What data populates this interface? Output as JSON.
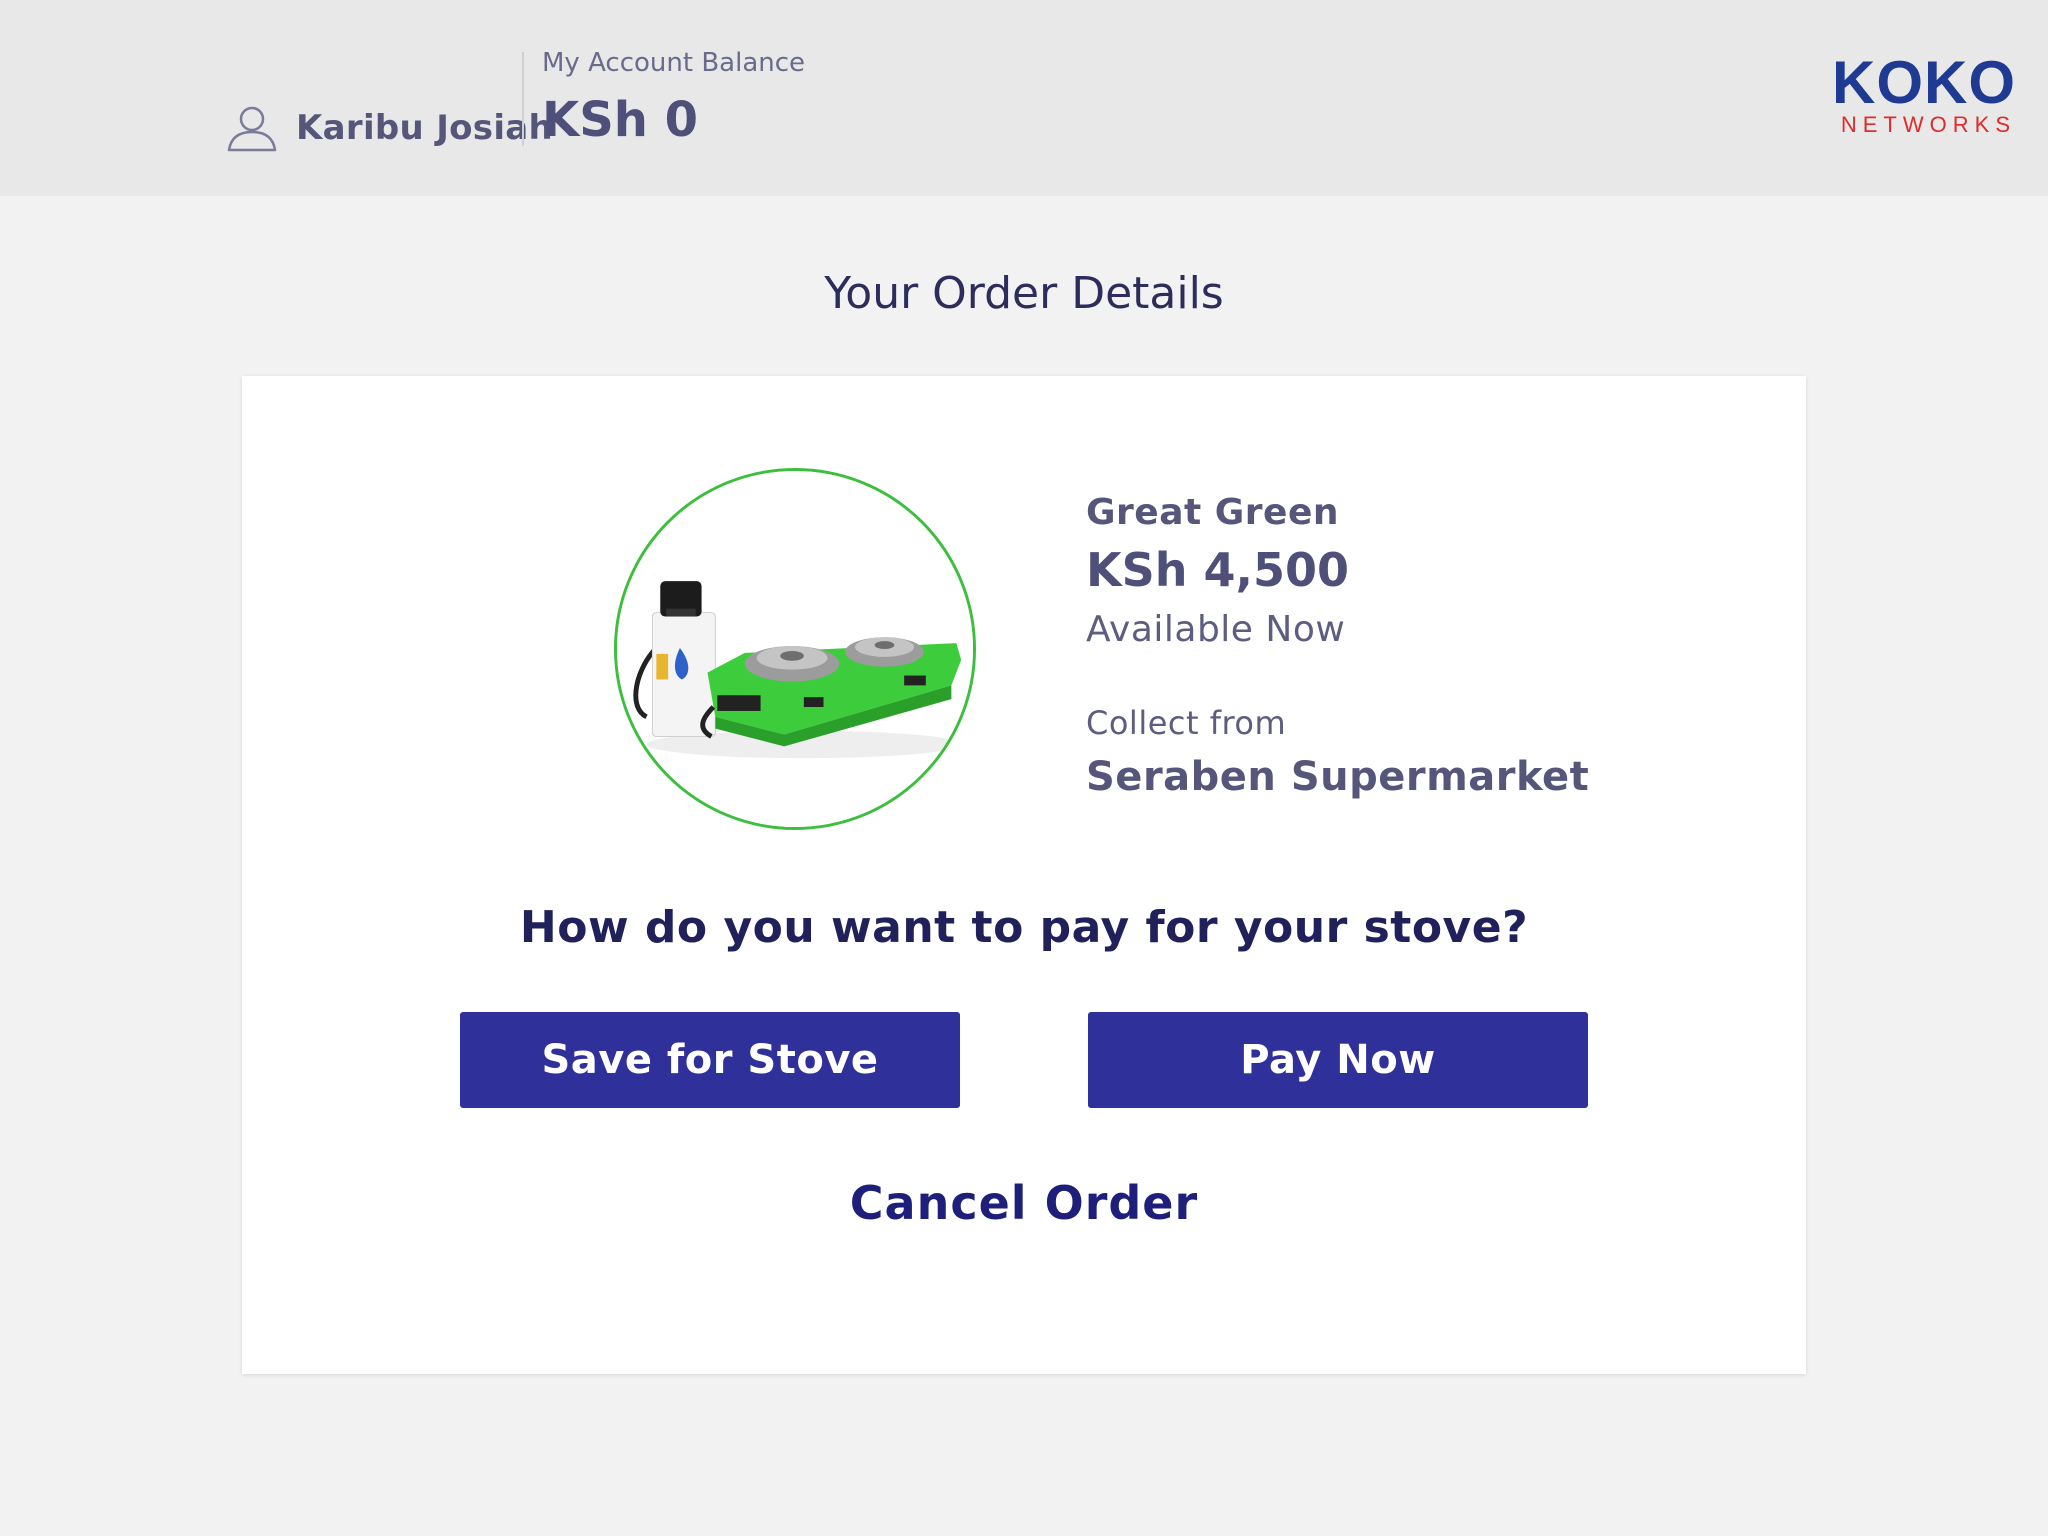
{
  "header": {
    "user_name": "Karibu Josiah",
    "user_icon": "user-icon",
    "balance_label": "My Account Balance",
    "balance_value": "KSh 0",
    "logo": {
      "primary": "KOKO",
      "secondary": "NETWORKS",
      "primary_color": "#1f3a93",
      "secondary_color": "#e02b2b"
    }
  },
  "page": {
    "title": "Your Order Details"
  },
  "order": {
    "product_name": "Great Green",
    "price": "KSh 4,500",
    "availability": "Available Now",
    "collect_label": "Collect from",
    "collect_location": "Seraben Supermarket",
    "image": "stove-product-image",
    "circle_color": "#3cbf3c"
  },
  "payment": {
    "question": "How do you want to pay for your stove?",
    "save_button_label": "Save for Stove",
    "pay_button_label": "Pay Now",
    "button_color": "#30309b"
  },
  "cancel": {
    "label": "Cancel Order"
  }
}
